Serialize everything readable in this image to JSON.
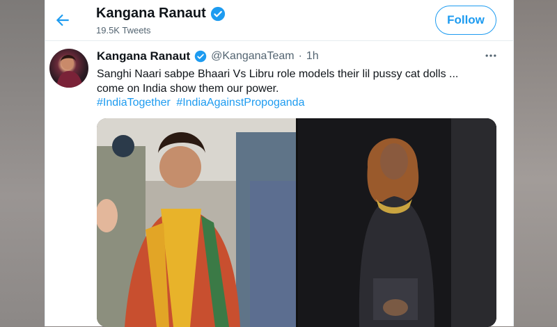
{
  "header": {
    "display_name": "Kangana Ranaut",
    "tweet_count": "19.5K Tweets",
    "follow_label": "Follow"
  },
  "tweet": {
    "author_name": "Kangana Ranaut",
    "handle": "@KanganaTeam",
    "separator": "·",
    "time": "1h",
    "text_line1": "Sanghi Naari sabpe Bhaari Vs Libru role models their lil pussy cat dolls ...",
    "text_line2": "come on India show them our power.",
    "hashtags": [
      "#IndiaTogether",
      "#IndiaAgainstPropoganda"
    ]
  },
  "icons": {
    "back": "arrow-left-icon",
    "verified": "verified-badge-icon",
    "more": "more-horizontal-icon"
  },
  "colors": {
    "accent": "#1d9bf0",
    "text_primary": "#0f1419",
    "text_secondary": "#536471"
  }
}
